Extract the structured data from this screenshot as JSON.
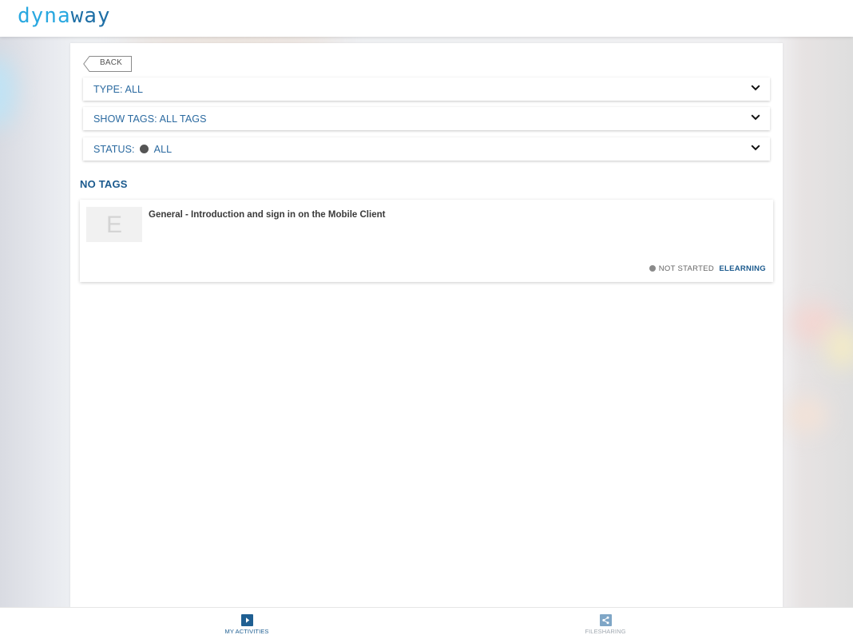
{
  "app": {
    "logo_part1": "dyna",
    "logo_part2": "way"
  },
  "toolbar": {
    "back_label": "BACK"
  },
  "filters": {
    "type_label": "TYPE: ALL",
    "tags_label": "SHOW TAGS: ALL TAGS",
    "status_prefix": "STATUS:",
    "status_value": "ALL"
  },
  "section": {
    "title": "NO TAGS"
  },
  "activities": [
    {
      "thumb_letter": "E",
      "title": "General - Introduction and sign in on the Mobile Client",
      "status": "NOT STARTED",
      "type": "ELEARNING"
    }
  ],
  "bottom_nav": {
    "items": [
      {
        "label": "MY ACTIVITIES",
        "icon": "play-icon",
        "active": true
      },
      {
        "label": "FILESHARING",
        "icon": "share-icon",
        "active": false
      }
    ]
  },
  "colors": {
    "accent": "#1b5a8e",
    "logo_light": "#29a8e0",
    "logo_dark": "#1e6fa6",
    "nav_active": "#1f5f92",
    "nav_inactive": "#7fa6c6",
    "status_dot": "#8a8a8a"
  }
}
